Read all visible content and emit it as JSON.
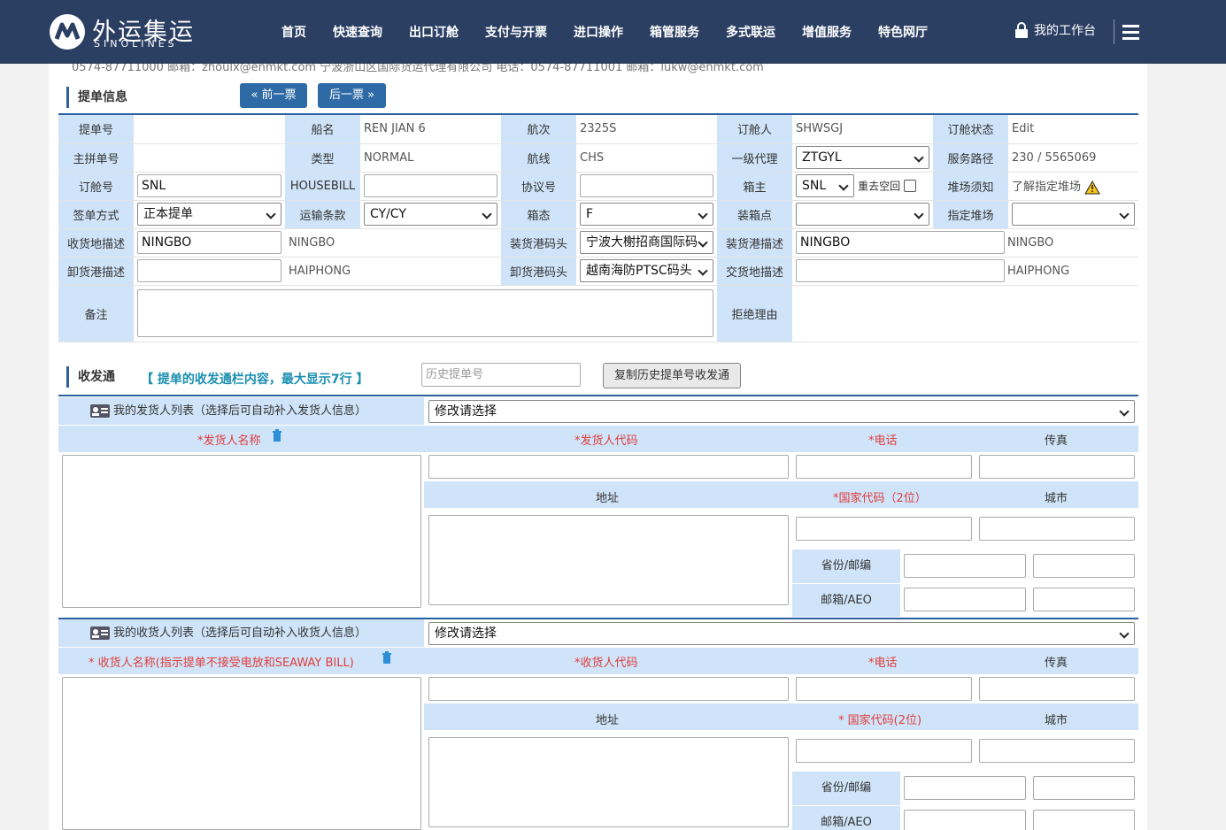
{
  "header": {
    "logo_cn": "外运集运",
    "logo_en": "SINOLINES",
    "nav": [
      "首页",
      "快速查询",
      "出口订舱",
      "支付与开票",
      "进口操作",
      "箱管服务",
      "多式联运",
      "增值服务",
      "特色网厅"
    ],
    "workspace": "我的工作台"
  },
  "scroll_text": "0574-87711000 邮箱：zhoulx@enmkt.com 宁波浙山区国际货运代理有限公司 电话：0574-87711001 邮箱：lukw@enmkt.com",
  "bl_section": {
    "title": "提单信息",
    "prev": "« 前一票",
    "next": "后一票 »",
    "labels": {
      "bl_no": "提单号",
      "vessel": "船名",
      "voyage": "航次",
      "booker": "订舱人",
      "status": "订舱状态",
      "master_bl": "主拼单号",
      "type": "类型",
      "route": "航线",
      "agent": "一级代理",
      "service_path": "服务路径",
      "booking_no": "订舱号",
      "housebill": "HOUSEBILL",
      "contract": "协议号",
      "carrier": "箱主",
      "yard_note": "堆场须知",
      "issue": "签单方式",
      "terms": "运输条款",
      "cntr_status": "箱态",
      "stuffing": "装箱点",
      "yard": "指定堆场",
      "receipt": "收货地描述",
      "load_term": "装货港码头",
      "load_port": "装货港描述",
      "discharge": "卸货港描述",
      "disc_term": "卸货港码头",
      "delivery": "交货地描述",
      "remark": "备注",
      "reject": "拒绝理由"
    },
    "values": {
      "bl_no": "",
      "vessel": "REN JIAN 6",
      "voyage": "2325S",
      "booker": "SHWSGJ",
      "status": "Edit",
      "master_bl": "",
      "type": "NORMAL",
      "route": "CHS",
      "agent": "ZTGYL",
      "service_path": "230 / 5565069",
      "booking_no": "SNL",
      "housebill": "",
      "contract": "",
      "carrier": "SNL",
      "return_empty": "重去空回",
      "yard_note": "了解指定堆场",
      "issue": "正本提单",
      "terms": "CY/CY",
      "cntr_status": "F",
      "stuffing": "",
      "yard": "",
      "receipt_input": "NINGBO",
      "receipt": "NINGBO",
      "load_term": "宁波大榭招商国际码",
      "load_port_input": "NINGBO",
      "load_port": "NINGBO",
      "discharge_input": "",
      "discharge": "HAIPHONG",
      "disc_term": "越南海防PTSC码头",
      "delivery_input": "",
      "delivery": "HAIPHONG"
    }
  },
  "party_section": {
    "title": "收发通",
    "hint": "【 提单的收发通栏内容，最大显示7行 】",
    "history_placeholder": "历史提单号",
    "copy_btn": "复制历史提单号收发通"
  },
  "shipper": {
    "list_label": "我的发货人列表（选择后可自动补入发货人信息）",
    "select": "修改请选择",
    "name": "*发货人名称",
    "code": "*发货人代码",
    "phone": "*电话",
    "fax": "传真",
    "addr": "地址",
    "country": "*国家代码（2位）",
    "city": "城市",
    "prov": "省份/邮编",
    "mail": "邮箱/AEO"
  },
  "consignee": {
    "list_label": "我的收货人列表（选择后可自动补入收货人信息）",
    "select": "修改请选择",
    "name": "* 收货人名称(指示提单不接受电放和SEAWAY BILL)",
    "code": "*收货人代码",
    "phone": "*电话",
    "fax": "传真",
    "addr": "地址",
    "country": "* 国家代码(2位)",
    "city": "城市",
    "prov": "省份/邮编",
    "mail": "邮箱/AEO"
  },
  "colors": {
    "nav_bg": "#2b3f63",
    "label_bg": "#cfe4f9",
    "accent": "#2e6aa6",
    "required": "#e03c3c"
  }
}
